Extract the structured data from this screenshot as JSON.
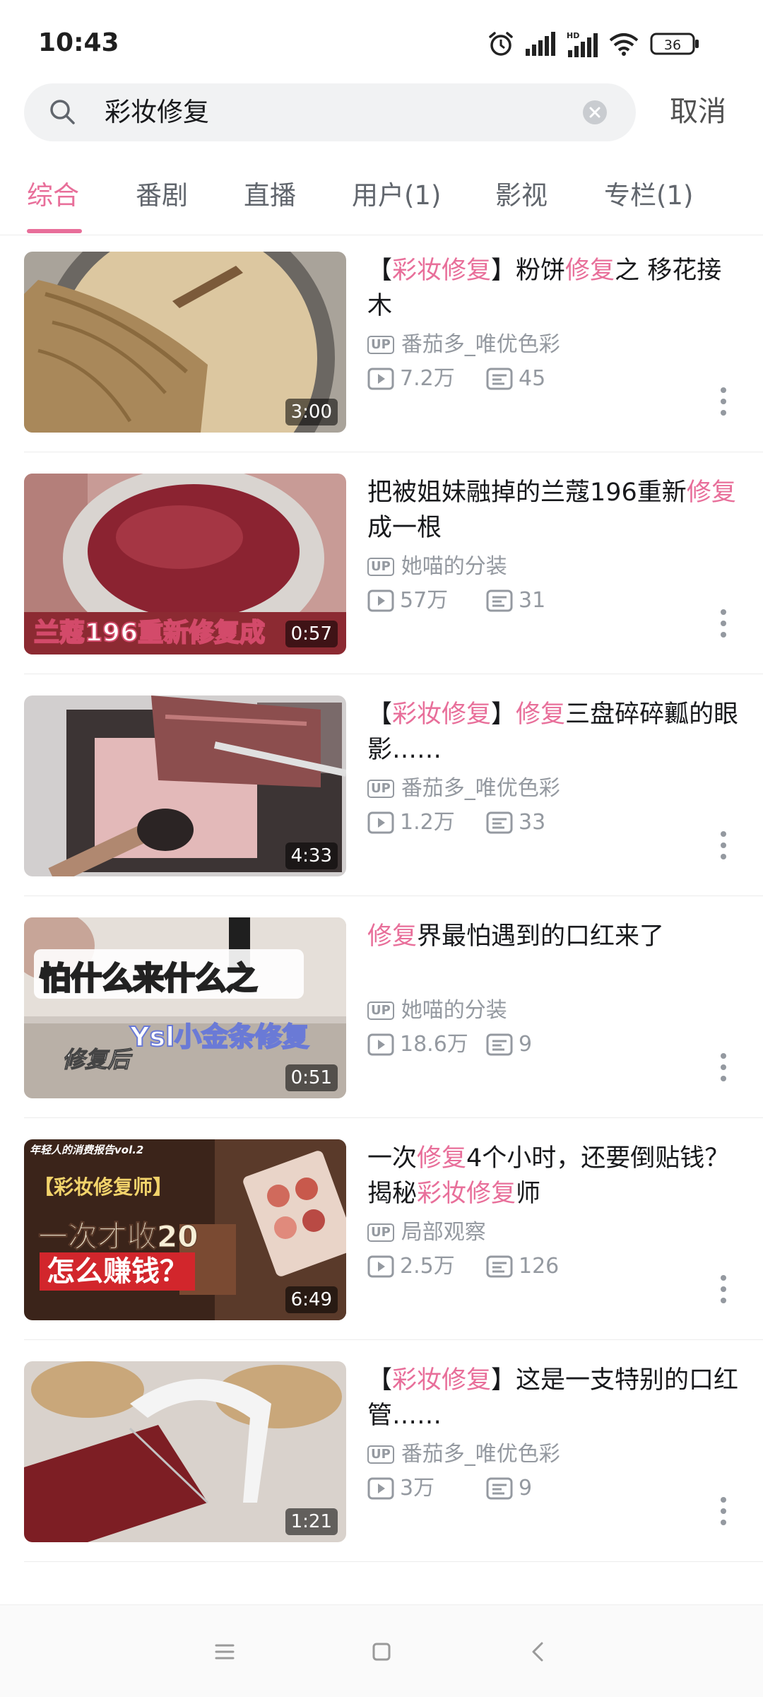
{
  "status_bar": {
    "time": "10:43",
    "battery": "36",
    "network_label": "HD",
    "icons": [
      "alarm-icon",
      "signal-icon",
      "hd-signal-icon",
      "wifi-icon",
      "battery-icon"
    ]
  },
  "search": {
    "query": "彩妆修复",
    "cancel_label": "取消"
  },
  "tabs": [
    {
      "label": "综合",
      "active": true
    },
    {
      "label": "番剧"
    },
    {
      "label": "直播"
    },
    {
      "label": "用户(1)"
    },
    {
      "label": "影视"
    },
    {
      "label": "专栏(1)"
    }
  ],
  "colors": {
    "accent": "#e86f9a",
    "meta": "#9499a0"
  },
  "results": [
    {
      "title_parts": [
        [
          "【",
          0
        ],
        [
          "彩妆修复",
          1
        ],
        [
          "】粉饼",
          0
        ],
        [
          "修复",
          1
        ],
        [
          "之 移花接木",
          0
        ]
      ],
      "duration": "3:00",
      "uploader": "番茄多_唯优色彩",
      "views": "7.2万",
      "comments": "45"
    },
    {
      "title_parts": [
        [
          "把被姐妹融掉的兰蔻196重新",
          0
        ],
        [
          "修复",
          1
        ],
        [
          "成一根",
          0
        ]
      ],
      "duration": "0:57",
      "thumb_caption": "兰蔻196重新修复成",
      "uploader": "她喵的分装",
      "views": "57万",
      "comments": "31"
    },
    {
      "title_parts": [
        [
          "【",
          0
        ],
        [
          "彩妆修复",
          1
        ],
        [
          "】",
          0
        ],
        [
          "修复",
          1
        ],
        [
          "三盘碎碎瓤的眼影……",
          0
        ]
      ],
      "duration": "4:33",
      "uploader": "番茄多_唯优色彩",
      "views": "1.2万",
      "comments": "33"
    },
    {
      "title_parts": [
        [
          "修复",
          1
        ],
        [
          "界最怕遇到的口红来了",
          0
        ]
      ],
      "duration": "0:51",
      "thumb_caption": "怕什么来什么之",
      "thumb_caption2": "Ysl小金条修复",
      "thumb_caption3": "修复后",
      "uploader": "她喵的分装",
      "views": "18.6万",
      "comments": "9"
    },
    {
      "title_parts": [
        [
          "一次",
          0
        ],
        [
          "修复",
          1
        ],
        [
          "4个小时，还要倒贴钱？揭秘",
          0
        ],
        [
          "彩妆修复",
          1
        ],
        [
          "师",
          0
        ]
      ],
      "duration": "6:49",
      "thumb_caption": "年轻人的消费报告vol.2",
      "thumb_caption2": "【彩妆修复师】",
      "thumb_caption3": "一次才收20",
      "thumb_caption4": "怎么赚钱？",
      "uploader": "局部观察",
      "views": "2.5万",
      "comments": "126"
    },
    {
      "title_parts": [
        [
          "【",
          0
        ],
        [
          "彩妆修复",
          1
        ],
        [
          "】这是一支特别的口红管……",
          0
        ]
      ],
      "duration": "1:21",
      "uploader": "番茄多_唯优色彩",
      "views": "3万",
      "comments": "9"
    }
  ],
  "nav_bar": {
    "icons": [
      "menu-icon",
      "home-icon",
      "back-icon"
    ]
  }
}
